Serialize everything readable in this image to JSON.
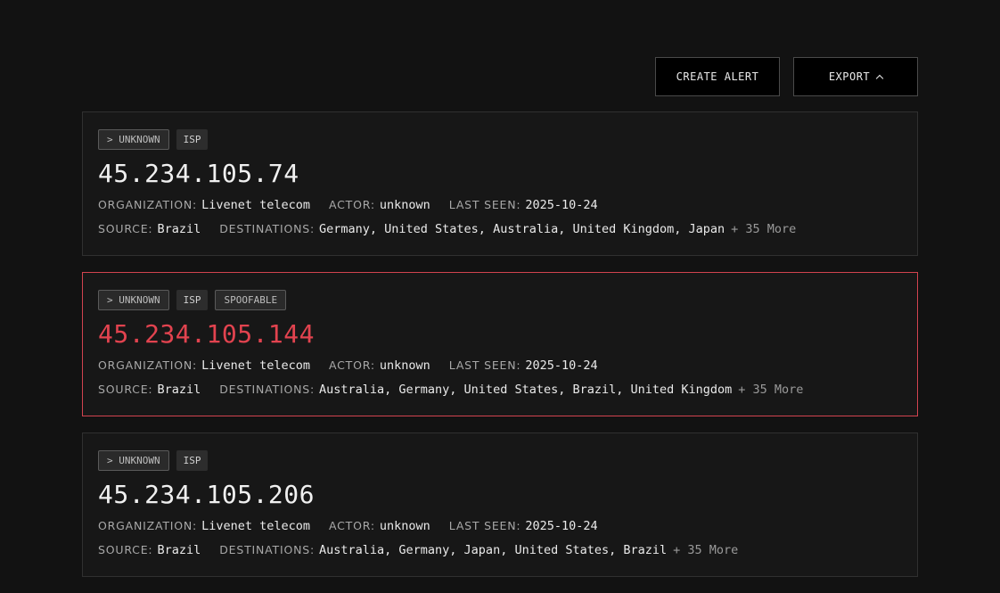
{
  "toolbar": {
    "create_alert": "CREATE ALERT",
    "export": "EXPORT"
  },
  "labels": {
    "organization": "ORGANIZATION:",
    "actor": "ACTOR:",
    "last_seen": "LAST SEEN:",
    "source": "SOURCE:",
    "destinations": "DESTINATIONS:"
  },
  "accent_color": "#e2434f",
  "cards": [
    {
      "tags": [
        "> UNKNOWN",
        "ISP"
      ],
      "ip": "45.234.105.74",
      "organization": "Livenet telecom",
      "actor": "unknown",
      "last_seen": "2025-10-24",
      "source": "Brazil",
      "destinations": "Germany, United States, Australia, United Kingdom, Japan",
      "more": "+ 35 More"
    },
    {
      "tags": [
        "> UNKNOWN",
        "ISP",
        "SPOOFABLE"
      ],
      "ip": "45.234.105.144",
      "organization": "Livenet telecom",
      "actor": "unknown",
      "last_seen": "2025-10-24",
      "source": "Brazil",
      "destinations": "Australia, Germany, United States, Brazil, United Kingdom",
      "more": "+ 35 More",
      "selected": true
    },
    {
      "tags": [
        "> UNKNOWN",
        "ISP"
      ],
      "ip": "45.234.105.206",
      "organization": "Livenet telecom",
      "actor": "unknown",
      "last_seen": "2025-10-24",
      "source": "Brazil",
      "destinations": "Australia, Germany, Japan, United States, Brazil",
      "more": "+ 35 More"
    }
  ]
}
